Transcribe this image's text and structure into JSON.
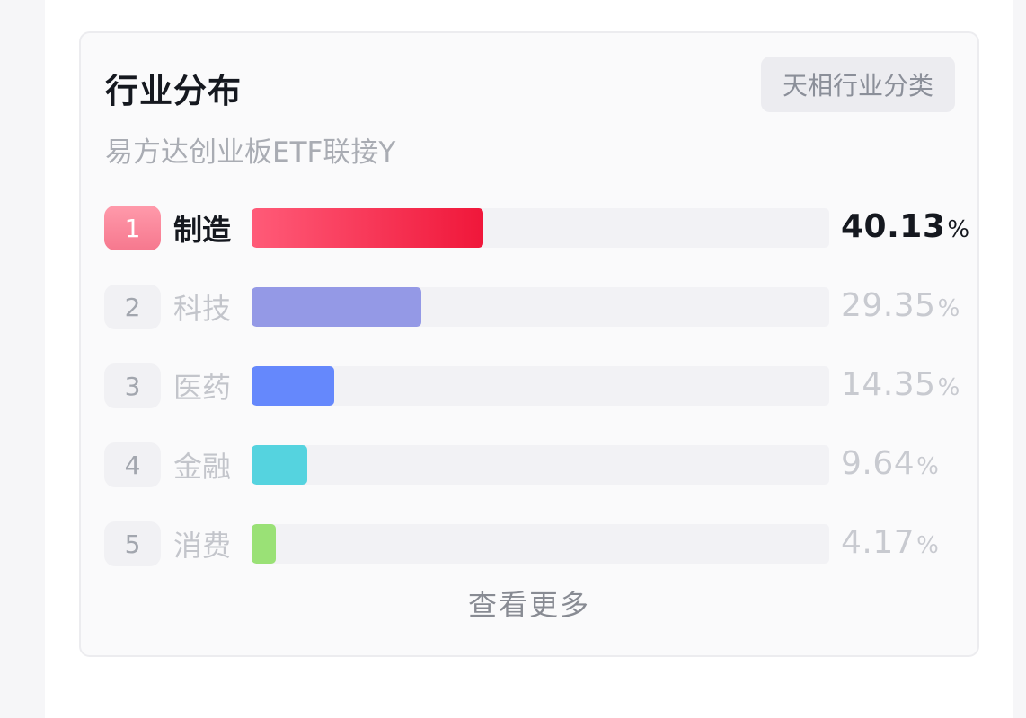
{
  "card": {
    "title": "行业分布",
    "classify_label": "天相行业分类",
    "subtitle": "易方达创业板ETF联接Y",
    "more_label": "查看更多"
  },
  "industries": [
    {
      "rank": "1",
      "name": "制造",
      "value": "40.13",
      "unit": "%",
      "fraction": 0.4013,
      "color": "#f0173a",
      "gradient_from": "#ff5b78"
    },
    {
      "rank": "2",
      "name": "科技",
      "value": "29.35",
      "unit": "%",
      "fraction": 0.2935,
      "color": "#9499e6"
    },
    {
      "rank": "3",
      "name": "医药",
      "value": "14.35",
      "unit": "%",
      "fraction": 0.1435,
      "color": "#6588fc"
    },
    {
      "rank": "4",
      "name": "金融",
      "value": "9.64",
      "unit": "%",
      "fraction": 0.0964,
      "color": "#55d3df"
    },
    {
      "rank": "5",
      "name": "消费",
      "value": "4.17",
      "unit": "%",
      "fraction": 0.0417,
      "color": "#9ae176"
    }
  ]
}
